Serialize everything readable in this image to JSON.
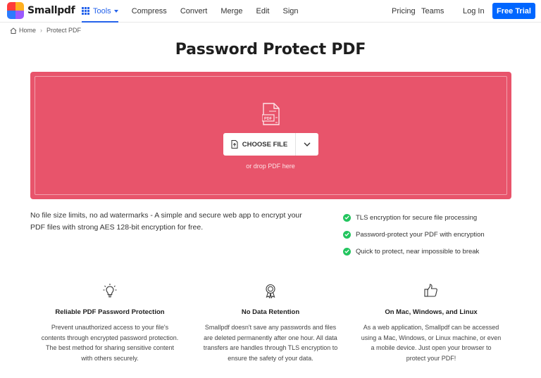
{
  "brand": {
    "name": "Smallpdf",
    "colors": [
      "#ff3b3b",
      "#ffb020",
      "#2b7bff",
      "#9b59ff"
    ]
  },
  "nav": {
    "tools_label": "Tools",
    "links": [
      "Compress",
      "Convert",
      "Merge",
      "Edit",
      "Sign"
    ],
    "pricing": "Pricing",
    "teams": "Teams",
    "login": "Log In",
    "free_trial": "Free Trial"
  },
  "breadcrumb": {
    "home": "Home",
    "current": "Protect PDF"
  },
  "page_title": "Password Protect PDF",
  "dropzone": {
    "color": "#e8546b",
    "file_icon_label": "PDF",
    "choose_label": "CHOOSE FILE",
    "drop_hint": "or drop PDF here"
  },
  "description": "No file size limits, no ad watermarks - A simple and secure web app to encrypt your PDF files with strong AES 128-bit encryption for free.",
  "features": [
    "TLS encryption for secure file processing",
    "Password-protect your PDF with encryption",
    "Quick to protect, near impossible to break"
  ],
  "columns": [
    {
      "icon": "lightbulb-icon",
      "title": "Reliable PDF Password Protection",
      "text": "Prevent unauthorized access to your file's contents through encrypted password protection. The best method for sharing sensitive content with others securely."
    },
    {
      "icon": "award-icon",
      "title": "No Data Retention",
      "text": "Smallpdf doesn't save any passwords and files are deleted permanently after one hour. All data transfers are handles through TLS encryption to ensure the safety of your data."
    },
    {
      "icon": "thumbs-up-icon",
      "title": "On Mac, Windows, and Linux",
      "text": "As a web application, Smallpdf can be accessed using a Mac, Windows, or Linux machine, or even a mobile device. Just open your browser to protect your PDF!"
    }
  ]
}
